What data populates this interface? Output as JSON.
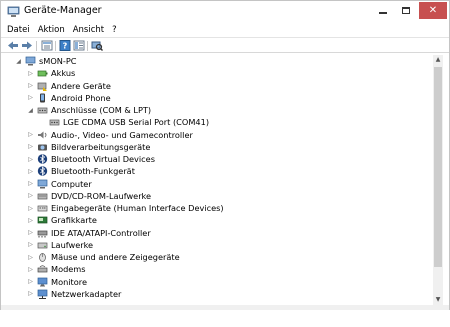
{
  "window": {
    "title": "Geräte-Manager"
  },
  "menu": [
    "Datei",
    "Aktion",
    "Ansicht",
    "?"
  ],
  "toolbar": {
    "buttons": [
      "back-arrow-icon",
      "forward-arrow-icon",
      "properties-icon",
      "help-icon",
      "view-icon",
      "scan-hardware-icon"
    ]
  },
  "tree": {
    "root": "sMON-PC",
    "items": [
      {
        "label": "Akkus",
        "icon": "battery-icon",
        "expanded": false
      },
      {
        "label": "Andere Geräte",
        "icon": "unknown-device-icon",
        "expanded": false
      },
      {
        "label": "Android Phone",
        "icon": "phone-icon",
        "expanded": false
      },
      {
        "label": "Anschlüsse (COM & LPT)",
        "icon": "port-icon",
        "expanded": true
      },
      {
        "label": "LGE CDMA USB Serial Port (COM41)",
        "icon": "port-icon",
        "child": true
      },
      {
        "label": "Audio-, Video- und Gamecontroller",
        "icon": "speaker-icon",
        "expanded": false
      },
      {
        "label": "Bildverarbeitungsgeräte",
        "icon": "camera-icon",
        "expanded": false
      },
      {
        "label": "Bluetooth Virtual Devices",
        "icon": "bluetooth-icon",
        "expanded": false
      },
      {
        "label": "Bluetooth-Funkgerät",
        "icon": "bluetooth-icon",
        "expanded": false
      },
      {
        "label": "Computer",
        "icon": "computer-icon",
        "expanded": false
      },
      {
        "label": "DVD/CD-ROM-Laufwerke",
        "icon": "disc-drive-icon",
        "expanded": false
      },
      {
        "label": "Eingabegeräte (Human Interface Devices)",
        "icon": "hid-icon",
        "expanded": false
      },
      {
        "label": "Grafikkarte",
        "icon": "display-adapter-icon",
        "expanded": false
      },
      {
        "label": "IDE ATA/ATAPI-Controller",
        "icon": "ide-controller-icon",
        "expanded": false
      },
      {
        "label": "Laufwerke",
        "icon": "disk-drive-icon",
        "expanded": false
      },
      {
        "label": "Mäuse und andere Zeigegeräte",
        "icon": "mouse-icon",
        "expanded": false
      },
      {
        "label": "Modems",
        "icon": "modem-icon",
        "expanded": false
      },
      {
        "label": "Monitore",
        "icon": "monitor-icon",
        "expanded": false
      },
      {
        "label": "Netzwerkadapter",
        "icon": "network-adapter-icon",
        "expanded": false
      }
    ]
  },
  "colors": {
    "close_button": "#c75050",
    "selection": "#cce8ff"
  }
}
